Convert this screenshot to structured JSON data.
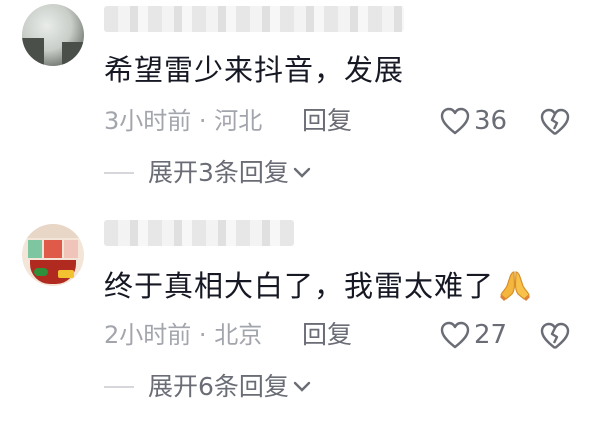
{
  "comments": [
    {
      "text": "希望雷少来抖音，发展",
      "time": "3小时前",
      "sep": "·",
      "location": "河北",
      "reply_label": "回复",
      "likes": "36",
      "expand_label": "展开3条回复"
    },
    {
      "text": "终于真相大白了，我雷太难了",
      "emoji": "folded-hands",
      "time": "2小时前",
      "sep": "·",
      "location": "北京",
      "reply_label": "回复",
      "likes": "27",
      "expand_label": "展开6条回复"
    }
  ],
  "icons": {
    "like": "heart-outline-icon",
    "dislike": "broken-heart-icon",
    "expand": "chevron-down-icon"
  },
  "colors": {
    "text": "#161823",
    "meta": "#a3a5ad",
    "action": "#6b6d76"
  }
}
